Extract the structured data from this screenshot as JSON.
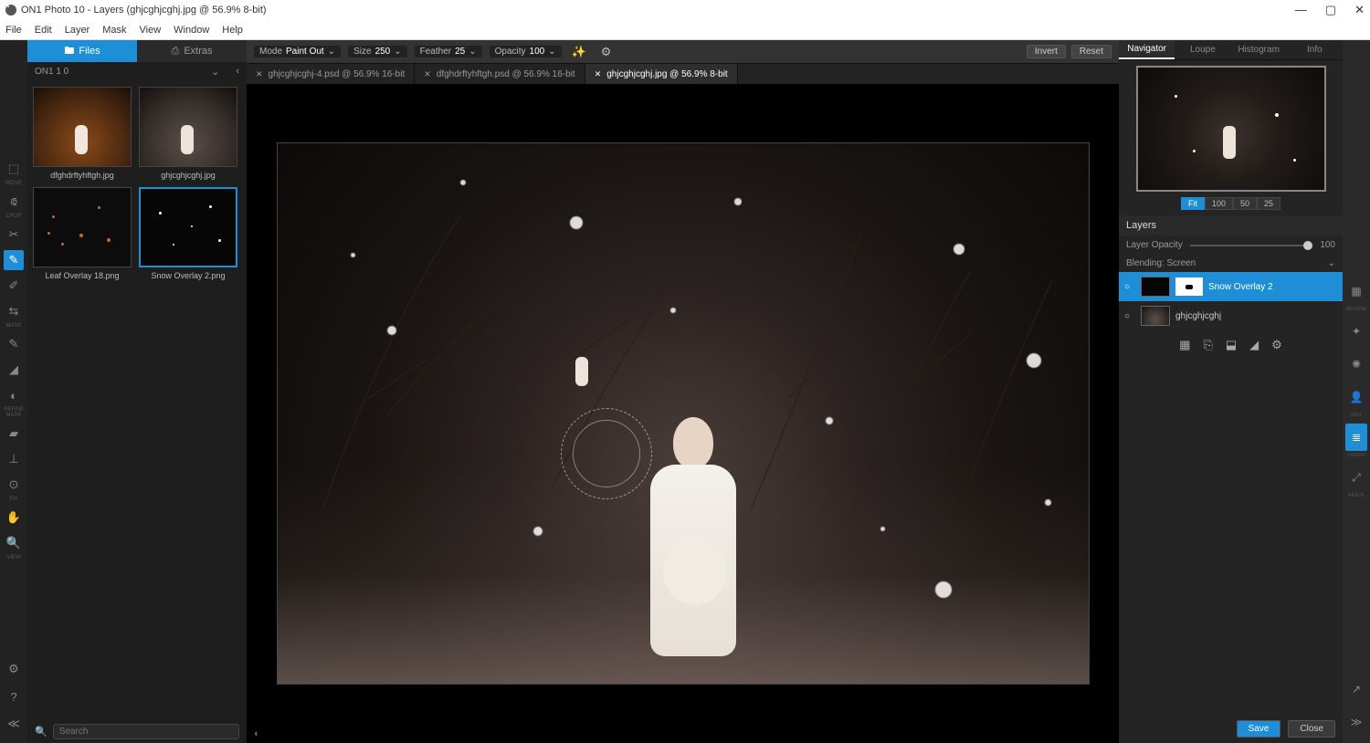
{
  "window": {
    "title": "ON1 Photo 10 - Layers (ghjcghjcghj.jpg @ 56.9% 8-bit)",
    "min": "—",
    "max": "▢",
    "close": "✕"
  },
  "menu": [
    "File",
    "Edit",
    "Layer",
    "Mask",
    "View",
    "Window",
    "Help"
  ],
  "browser": {
    "tabs": {
      "files": "Files",
      "extras": "Extras"
    },
    "breadcrumb": "ON1 1 0",
    "thumbs": [
      {
        "label": "dfghdrftyhftgh.jpg"
      },
      {
        "label": "ghjcghjcghj.jpg"
      },
      {
        "label": "Leaf Overlay 18.png"
      },
      {
        "label": "Snow Overlay 2.png"
      }
    ],
    "search_placeholder": "Search"
  },
  "options": {
    "mode": {
      "label": "Mode",
      "value": "Paint Out"
    },
    "size": {
      "label": "Size",
      "value": "250"
    },
    "feather": {
      "label": "Feather",
      "value": "25"
    },
    "opacity": {
      "label": "Opacity",
      "value": "100"
    },
    "invert": "Invert",
    "reset": "Reset"
  },
  "docs": [
    {
      "name": "ghjcghjcghj-4.psd @ 56.9% 16-bit"
    },
    {
      "name": "dfghdrftyhftgh.psd @ 56.9% 16-bit"
    },
    {
      "name": "ghjcghjcghj.jpg @ 56.9% 8-bit"
    }
  ],
  "right": {
    "tabs": [
      "Navigator",
      "Loupe",
      "Histogram",
      "Info"
    ],
    "zoom": [
      "Fit",
      "100",
      "50",
      "25"
    ],
    "layers_header": "Layers",
    "opacity_label": "Layer Opacity",
    "opacity_value": "100",
    "blending_label": "Blending",
    "blending_value": "Screen",
    "layers": [
      {
        "name": "Snow Overlay 2"
      },
      {
        "name": "ghjcghjcghj"
      }
    ]
  },
  "footer": {
    "save": "Save",
    "close": "Close"
  },
  "modules": {
    "browse": "BROWSE",
    "edit": "EDIT",
    "layers": "LAYERS",
    "resize": "RESIZE"
  }
}
